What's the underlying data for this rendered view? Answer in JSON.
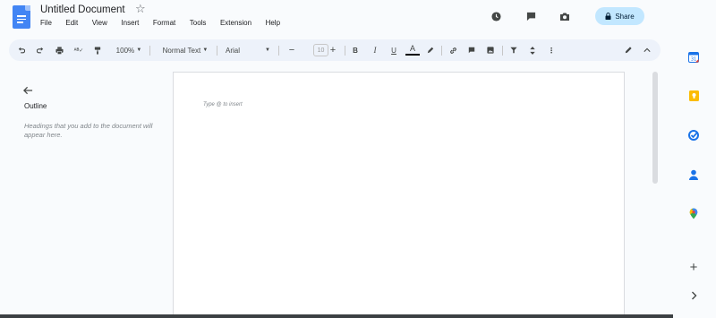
{
  "header": {
    "doc_title": "Untitled Document",
    "menu": [
      "File",
      "Edit",
      "View",
      "Insert",
      "Format",
      "Tools",
      "Extension",
      "Help"
    ],
    "share_label": "Share"
  },
  "toolbar": {
    "zoom": "100%",
    "style": "Normal Text",
    "font": "Arial",
    "font_size": "10"
  },
  "outline": {
    "title": "Outline",
    "hint": "Headings that you add to the document will appear here."
  },
  "page": {
    "hint": "Type @ to insert"
  },
  "colors": {
    "share_bg": "#c2e7ff",
    "toolbar_bg": "#edf2fa",
    "docs_blue": "#4285f4",
    "keep_yellow": "#fbbc04",
    "tasks_blue": "#1a73e8"
  }
}
